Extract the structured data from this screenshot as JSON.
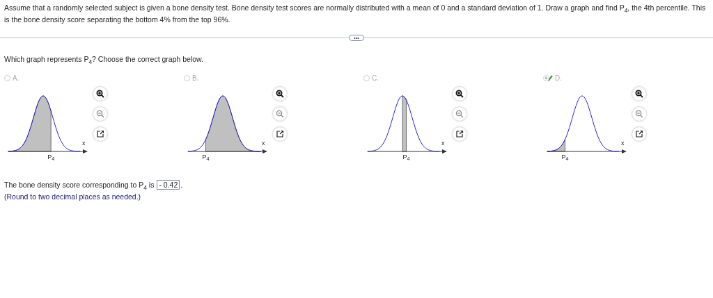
{
  "problem": {
    "text": "Assume that a randomly selected subject is given a bone density test. Bone density test scores are normally distributed with a mean of 0 and a standard deviation of 1. Draw a graph and find P$_{4}$, the 4th percentile. This is the bone density score separating the bottom 4% from the top 96%."
  },
  "divider_button": {
    "label": "•••"
  },
  "question": {
    "text": "Which graph represents P$_{4}$? Choose the correct graph below."
  },
  "options": [
    {
      "label": "A.",
      "selected": false,
      "correct": false,
      "kind": "below_high_cut",
      "axis_label": "x",
      "cut_label": "P$_{4}$"
    },
    {
      "label": "B.",
      "selected": false,
      "correct": false,
      "kind": "above_low_cut",
      "axis_label": "x",
      "cut_label": "P$_{4}$"
    },
    {
      "label": "C.",
      "selected": false,
      "correct": false,
      "kind": "mean_to_cut",
      "axis_label": "x",
      "cut_label": "P$_{4}$"
    },
    {
      "label": "D.",
      "selected": true,
      "correct": true,
      "kind": "below_low_cut",
      "axis_label": "x",
      "cut_label": "P$_{4}$"
    }
  ],
  "answer": {
    "prefix": "The bone density score corresponding to P$_{4}$ is",
    "value": "- 0.42",
    "suffix": ".",
    "hint": "(Round to two decimal places as needed.)"
  }
}
